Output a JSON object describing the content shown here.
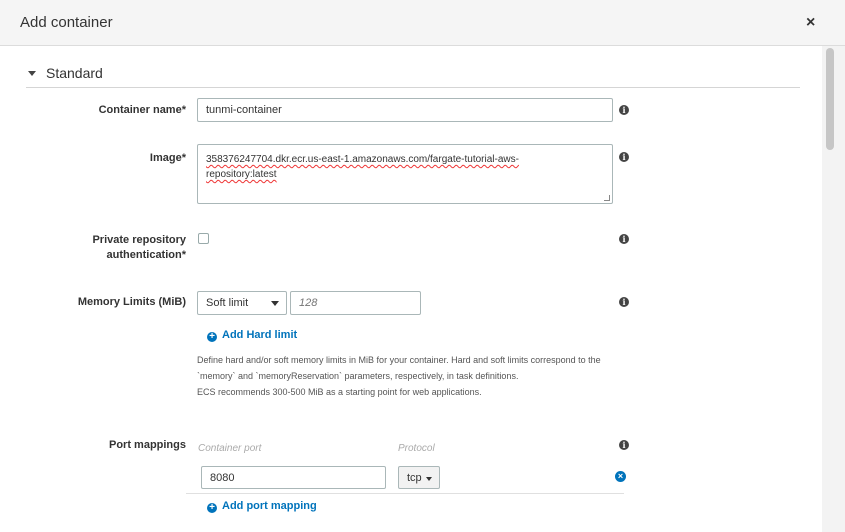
{
  "dialog": {
    "title": "Add container",
    "close_glyph": "×"
  },
  "section": {
    "title": "Standard"
  },
  "fields": {
    "container_name": {
      "label": "Container name*",
      "value": "tunmi-container"
    },
    "image": {
      "label": "Image*",
      "line1": "358376247704.dkr.ecr.us-east-1.amazonaws.com/fargate-tutorial-aws-",
      "line2": "repository:latest"
    },
    "private_repo": {
      "label_line1": "Private repository",
      "label_line2": "authentication*",
      "checked": false
    },
    "memory": {
      "label": "Memory Limits (MiB)",
      "select_value": "Soft limit",
      "placeholder": "128",
      "add_link": "Add Hard limit",
      "help_line1": "Define hard and/or soft memory limits in MiB for your container. Hard and soft limits correspond to the",
      "help_line2": "`memory` and `memoryReservation` parameters, respectively, in task definitions.",
      "help_line3": "ECS recommends 300-500 MiB as a starting point for web applications."
    },
    "port_mappings": {
      "label": "Port mappings",
      "col_container_port": "Container port",
      "col_protocol": "Protocol",
      "rows": [
        {
          "container_port": "8080",
          "protocol": "tcp"
        }
      ],
      "add_link": "Add port mapping"
    }
  },
  "info_glyph": "i",
  "plus_glyph": "+",
  "remove_glyph": "×",
  "colors": {
    "link": "#0073bb",
    "header_bg": "#f5f5f5",
    "border": "#aab7b8"
  }
}
